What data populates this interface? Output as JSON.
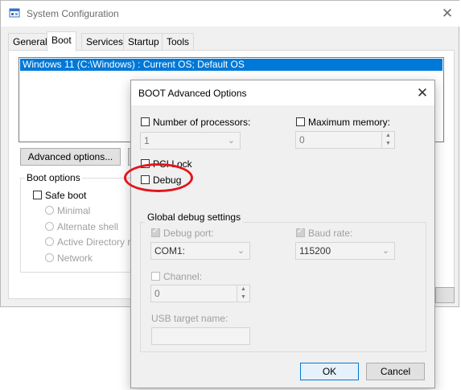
{
  "main_window": {
    "title": "System Configuration",
    "close_glyph": "✕",
    "tabs": [
      "General",
      "Boot",
      "Services",
      "Startup",
      "Tools"
    ],
    "active_tab": "Boot",
    "os_entry": "Windows 11 (C:\\Windows) : Current OS; Default OS",
    "advanced_options_label": "Advanced options...",
    "boot_options": {
      "label": "Boot options",
      "safe_boot": "Safe boot",
      "radios": [
        "Minimal",
        "Alternate shell",
        "Active Directory rep",
        "Network"
      ]
    }
  },
  "dialog": {
    "title": "BOOT Advanced Options",
    "close_glyph": "✕",
    "num_processors": {
      "label": "Number of processors:",
      "checked": false,
      "value": "1"
    },
    "max_memory": {
      "label": "Maximum memory:",
      "checked": false,
      "value": "0"
    },
    "pci_lock": {
      "label": "PCI Lock",
      "checked": false
    },
    "debug": {
      "label": "Debug",
      "checked": false
    },
    "global_debug": {
      "label": "Global debug settings",
      "debug_port": {
        "label": "Debug port:",
        "checked": true,
        "value": "COM1:"
      },
      "baud_rate": {
        "label": "Baud rate:",
        "checked": true,
        "value": "115200"
      },
      "channel": {
        "label": "Channel:",
        "checked": false,
        "value": "0"
      },
      "usb_target": {
        "label": "USB target name:",
        "value": ""
      }
    },
    "ok_label": "OK",
    "cancel_label": "Cancel"
  },
  "annotation": {
    "color": "#e3141b",
    "shape": "ellipse",
    "target": "Debug"
  },
  "icons": {
    "app": "system-config-icon",
    "dropdown": "chevron-down-icon"
  },
  "colors": {
    "selection": "#0078d7",
    "window_bg": "#f0f0f0"
  }
}
